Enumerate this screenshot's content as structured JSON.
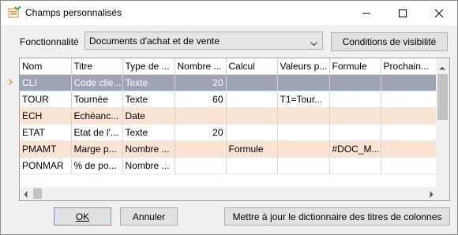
{
  "window": {
    "title": "Champs personnalisés"
  },
  "toolbar": {
    "functionality_label": "Fonctionnalité",
    "functionality_value": "Documents d'achat et de vente",
    "conditions_button": "Conditions de visibilité"
  },
  "grid": {
    "columns": [
      "Nom",
      "Titre",
      "Type de ...",
      "Nombre ...",
      "Calcul",
      "Valeurs p...",
      "Formule",
      "Prochain..."
    ],
    "rows": [
      {
        "nom": "CLI",
        "titre": "Code clie...",
        "type": "Texte",
        "nombre": "20",
        "calcul": "",
        "valeurs": "",
        "formule": "",
        "prochain": ""
      },
      {
        "nom": "TOUR",
        "titre": "Tournée",
        "type": "Texte",
        "nombre": "60",
        "calcul": "",
        "valeurs": "T1=Tour...",
        "formule": "",
        "prochain": ""
      },
      {
        "nom": "ECH",
        "titre": "Echéanc...",
        "type": "Date",
        "nombre": "",
        "calcul": "",
        "valeurs": "",
        "formule": "",
        "prochain": ""
      },
      {
        "nom": "ETAT",
        "titre": "Etat de l'...",
        "type": "Texte",
        "nombre": "20",
        "calcul": "",
        "valeurs": "",
        "formule": "",
        "prochain": ""
      },
      {
        "nom": "PMAMT",
        "titre": "Marge p...",
        "type": "Nombre ...",
        "nombre": "",
        "calcul": "Formule",
        "valeurs": "",
        "formule": "#DOC_M...",
        "prochain": ""
      },
      {
        "nom": "PONMAR",
        "titre": "% de po...",
        "type": "Nombre ...",
        "nombre": "",
        "calcul": "",
        "valeurs": "",
        "formule": "",
        "prochain": ""
      }
    ]
  },
  "footer": {
    "ok_label": "OK",
    "cancel_label": "Annuler",
    "dictionary_label": "Mettre à jour le dictionnaire des titres de colonnes"
  }
}
